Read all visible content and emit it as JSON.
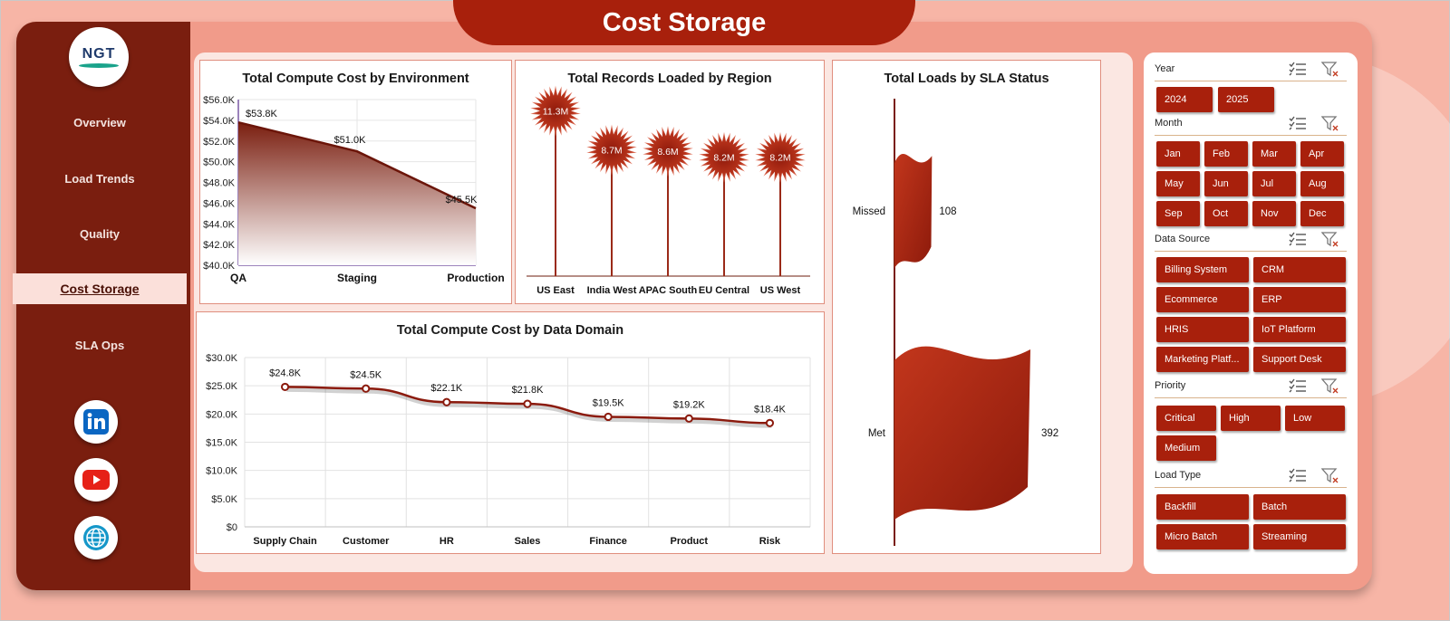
{
  "header": {
    "title": "Cost Storage"
  },
  "logo": {
    "text": "NGT"
  },
  "nav": {
    "items": [
      "Overview",
      "Load Trends",
      "Quality",
      "Cost Storage",
      "SLA Ops"
    ],
    "active": "Cost Storage"
  },
  "social": [
    "linkedin-icon",
    "youtube-icon",
    "globe-icon"
  ],
  "colors": {
    "primary": "#a8200c",
    "sidebar": "#7a1e0f",
    "background": "#f7b5a6",
    "board": "#f19b8a",
    "line": "#8b1a0d"
  },
  "charts": {
    "env": {
      "title": "Total Compute Cost by Environment"
    },
    "region": {
      "title": "Total Records Loaded by Region"
    },
    "sla": {
      "title": "Total Loads by SLA Status"
    },
    "domain": {
      "title": "Total Compute Cost by Data Domain"
    }
  },
  "chart_data": [
    {
      "type": "area",
      "title": "Total Compute Cost by Environment",
      "categories": [
        "QA",
        "Staging",
        "Production"
      ],
      "values": [
        53.8,
        51.0,
        45.5
      ],
      "data_labels": [
        "$53.8K",
        "$51.0K",
        "$45.5K"
      ],
      "ylim": [
        40.0,
        56.0
      ],
      "yticks": [
        "$40.0K",
        "$42.0K",
        "$44.0K",
        "$46.0K",
        "$48.0K",
        "$50.0K",
        "$52.0K",
        "$54.0K",
        "$56.0K"
      ]
    },
    {
      "type": "bar",
      "title": "Total Records Loaded by Region",
      "categories": [
        "US East",
        "India West",
        "APAC South",
        "EU Central",
        "US West"
      ],
      "values": [
        11.3,
        8.7,
        8.6,
        8.2,
        8.2
      ],
      "data_labels": [
        "11.3M",
        "8.7M",
        "8.6M",
        "8.2M",
        "8.2M"
      ]
    },
    {
      "type": "bar",
      "title": "Total Loads by SLA Status",
      "categories": [
        "Missed",
        "Met"
      ],
      "values": [
        108,
        392
      ],
      "data_labels": [
        "108",
        "392"
      ]
    },
    {
      "type": "line",
      "title": "Total Compute Cost by Data Domain",
      "categories": [
        "Supply Chain",
        "Customer",
        "HR",
        "Sales",
        "Finance",
        "Product",
        "Risk"
      ],
      "values": [
        24.8,
        24.5,
        22.1,
        21.8,
        19.5,
        19.2,
        18.4
      ],
      "data_labels": [
        "$24.8K",
        "$24.5K",
        "$22.1K",
        "$21.8K",
        "$19.5K",
        "$19.2K",
        "$18.4K"
      ],
      "ylim": [
        0,
        30
      ],
      "yticks": [
        "$0",
        "$5.0K",
        "$10.0K",
        "$15.0K",
        "$20.0K",
        "$25.0K",
        "$30.0K"
      ],
      "grid": true
    }
  ],
  "slicers": {
    "year": {
      "label": "Year",
      "items": [
        "2024",
        "2025"
      ]
    },
    "month": {
      "label": "Month",
      "items": [
        "Jan",
        "Feb",
        "Mar",
        "Apr",
        "May",
        "Jun",
        "Jul",
        "Aug",
        "Sep",
        "Oct",
        "Nov",
        "Dec"
      ]
    },
    "source": {
      "label": "Data Source",
      "items": [
        "Billing System",
        "CRM",
        "Ecommerce",
        "ERP",
        "HRIS",
        "IoT Platform",
        "Marketing Platf...",
        "Support Desk"
      ]
    },
    "priority": {
      "label": "Priority",
      "items": [
        "Critical",
        "High",
        "Low",
        "Medium"
      ]
    },
    "loadtype": {
      "label": "Load Type",
      "items": [
        "Backfill",
        "Batch",
        "Micro Batch",
        "Streaming"
      ]
    }
  }
}
